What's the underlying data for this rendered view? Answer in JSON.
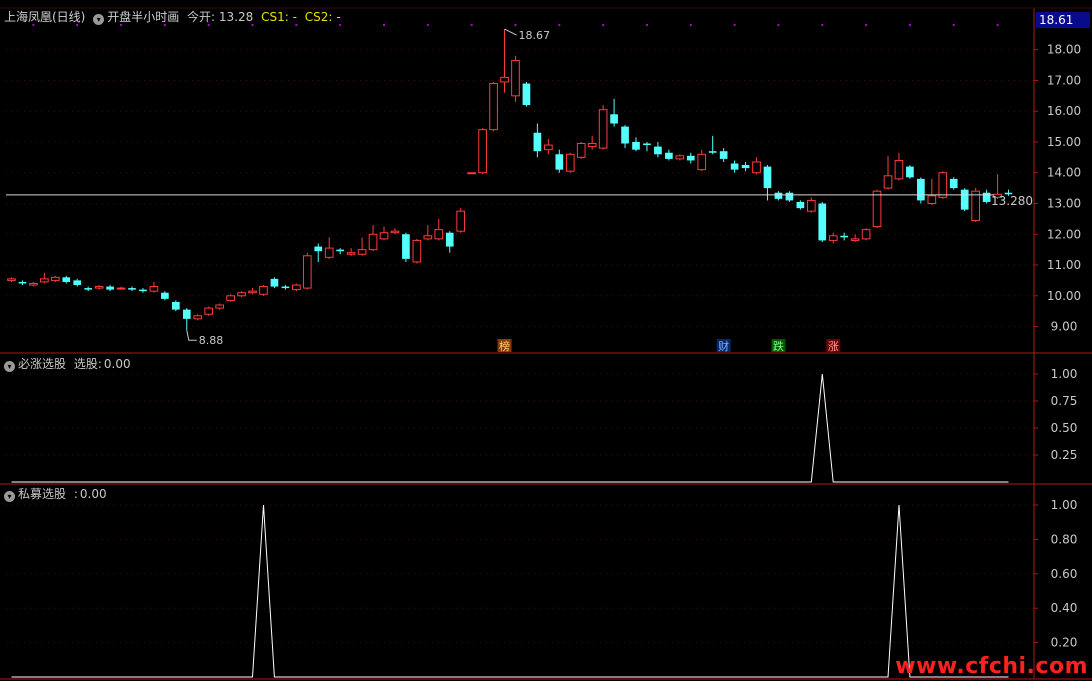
{
  "header": {
    "stock_name": "上海凤凰(日线)",
    "indicator_name": "开盘半小时画",
    "open_label": "今开:",
    "open_value": "13.28",
    "cs1_label": "CS1:",
    "cs1_value": "-",
    "cs2_label": "CS2:",
    "cs2_value": "-"
  },
  "current_price_box": "18.61",
  "panel2": {
    "title": "必涨选股",
    "label": "选股:",
    "value": "0.00"
  },
  "panel3": {
    "title": "私募选股",
    "label": ":",
    "value": "0.00"
  },
  "watermark": "www.cfchi.com",
  "colors": {
    "up": "#ff3b3b",
    "down": "#54ffff",
    "axis": "#b01818",
    "text": "#c8c8c8",
    "yellow": "#e8e000",
    "purple": "#b000d0"
  },
  "chart_data": [
    {
      "type": "candlestick",
      "ylim": [
        8.4,
        18.9
      ],
      "yticks": [
        "18.00",
        "17.00",
        "16.00",
        "15.00",
        "14.00",
        "13.00",
        "12.00",
        "11.00",
        "10.00",
        "9.00"
      ],
      "high_label": "18.67",
      "low_label": "8.88",
      "ref_line_label": "13.280",
      "ref_line_value": 13.28,
      "event_markers": [
        "榜",
        "财",
        "跌",
        "涨"
      ],
      "candles": [
        [
          10.5,
          10.55,
          10.6,
          10.45
        ],
        [
          10.45,
          10.4,
          10.5,
          10.35
        ],
        [
          10.35,
          10.4,
          10.45,
          10.3
        ],
        [
          10.45,
          10.55,
          10.75,
          10.4
        ],
        [
          10.5,
          10.6,
          10.65,
          10.45
        ],
        [
          10.6,
          10.45,
          10.65,
          10.4
        ],
        [
          10.5,
          10.35,
          10.55,
          10.3
        ],
        [
          10.25,
          10.2,
          10.3,
          10.15
        ],
        [
          10.25,
          10.3,
          10.35,
          10.2
        ],
        [
          10.3,
          10.2,
          10.35,
          10.15
        ],
        [
          10.25,
          10.25,
          10.3,
          10.2
        ],
        [
          10.25,
          10.2,
          10.3,
          10.15
        ],
        [
          10.2,
          10.15,
          10.25,
          10.1
        ],
        [
          10.15,
          10.3,
          10.45,
          10.1
        ],
        [
          10.1,
          9.9,
          10.15,
          9.85
        ],
        [
          9.8,
          9.55,
          9.85,
          9.5
        ],
        [
          9.55,
          9.25,
          9.6,
          8.88
        ],
        [
          9.25,
          9.35,
          9.4,
          9.2
        ],
        [
          9.4,
          9.6,
          9.65,
          9.35
        ],
        [
          9.6,
          9.7,
          9.75,
          9.55
        ],
        [
          9.85,
          10.0,
          10.05,
          9.8
        ],
        [
          10.0,
          10.1,
          10.15,
          9.95
        ],
        [
          10.1,
          10.15,
          10.25,
          10.05
        ],
        [
          10.05,
          10.3,
          10.35,
          10.0
        ],
        [
          10.55,
          10.3,
          10.6,
          10.25
        ],
        [
          10.3,
          10.25,
          10.35,
          10.2
        ],
        [
          10.2,
          10.35,
          10.4,
          10.15
        ],
        [
          10.25,
          11.3,
          11.4,
          10.2
        ],
        [
          11.6,
          11.45,
          11.7,
          11.1
        ],
        [
          11.25,
          11.55,
          11.9,
          11.2
        ],
        [
          11.5,
          11.45,
          11.55,
          11.35
        ],
        [
          11.35,
          11.4,
          11.55,
          11.3
        ],
        [
          11.35,
          11.5,
          11.9,
          11.3
        ],
        [
          11.5,
          12.0,
          12.3,
          11.45
        ],
        [
          11.85,
          12.05,
          12.25,
          11.8
        ],
        [
          12.05,
          12.1,
          12.2,
          12.0
        ],
        [
          12.0,
          11.2,
          12.05,
          11.1
        ],
        [
          11.1,
          11.8,
          11.85,
          11.05
        ],
        [
          11.85,
          11.95,
          12.3,
          11.8
        ],
        [
          11.85,
          12.15,
          12.5,
          11.8
        ],
        [
          12.05,
          11.6,
          12.1,
          11.4
        ],
        [
          12.1,
          12.75,
          12.85,
          12.05
        ],
        [
          14.0,
          14.0,
          14.0,
          14.0
        ],
        [
          14.0,
          15.4,
          15.45,
          13.95
        ],
        [
          15.4,
          16.9,
          16.95,
          15.35
        ],
        [
          16.95,
          17.1,
          18.67,
          16.6
        ],
        [
          16.5,
          17.65,
          17.8,
          16.3
        ],
        [
          16.9,
          16.2,
          16.95,
          16.15
        ],
        [
          15.3,
          14.7,
          15.6,
          14.5
        ],
        [
          14.75,
          14.9,
          15.1,
          14.6
        ],
        [
          14.6,
          14.1,
          14.75,
          14.0
        ],
        [
          14.05,
          14.6,
          14.65,
          14.0
        ],
        [
          14.5,
          14.95,
          15.0,
          14.45
        ],
        [
          14.85,
          14.95,
          15.2,
          14.75
        ],
        [
          14.8,
          16.05,
          16.2,
          14.75
        ],
        [
          15.9,
          15.6,
          16.4,
          15.5
        ],
        [
          15.5,
          14.95,
          15.55,
          14.8
        ],
        [
          15.0,
          14.75,
          15.15,
          14.7
        ],
        [
          14.95,
          14.9,
          15.0,
          14.7
        ],
        [
          14.85,
          14.6,
          15.0,
          14.5
        ],
        [
          14.65,
          14.45,
          14.75,
          14.4
        ],
        [
          14.45,
          14.55,
          14.6,
          14.4
        ],
        [
          14.55,
          14.4,
          14.65,
          14.3
        ],
        [
          14.1,
          14.6,
          14.75,
          14.05
        ],
        [
          14.7,
          14.65,
          15.2,
          14.6
        ],
        [
          14.7,
          14.45,
          14.8,
          14.35
        ],
        [
          14.3,
          14.1,
          14.4,
          14.0
        ],
        [
          14.25,
          14.15,
          14.35,
          14.05
        ],
        [
          14.0,
          14.35,
          14.5,
          13.95
        ],
        [
          14.2,
          13.5,
          14.25,
          13.1
        ],
        [
          13.35,
          13.15,
          13.4,
          13.1
        ],
        [
          13.35,
          13.1,
          13.4,
          13.05
        ],
        [
          13.05,
          12.85,
          13.1,
          12.8
        ],
        [
          12.75,
          13.1,
          13.2,
          12.7
        ],
        [
          13.0,
          11.8,
          13.05,
          11.75
        ],
        [
          11.8,
          11.95,
          12.05,
          11.7
        ],
        [
          11.95,
          11.9,
          12.05,
          11.8
        ],
        [
          11.8,
          11.85,
          12.0,
          11.75
        ],
        [
          11.85,
          12.15,
          12.2,
          11.8
        ],
        [
          12.25,
          13.4,
          13.45,
          12.2
        ],
        [
          13.5,
          13.9,
          14.55,
          13.45
        ],
        [
          13.8,
          14.4,
          14.65,
          13.75
        ],
        [
          14.2,
          13.85,
          14.25,
          13.8
        ],
        [
          13.8,
          13.1,
          13.85,
          13.0
        ],
        [
          13.0,
          13.25,
          13.8,
          12.95
        ],
        [
          13.2,
          14.0,
          14.05,
          13.15
        ],
        [
          13.8,
          13.5,
          13.85,
          13.45
        ],
        [
          13.45,
          12.8,
          13.5,
          12.75
        ],
        [
          12.45,
          13.4,
          13.5,
          12.4
        ],
        [
          13.35,
          13.05,
          13.45,
          13.0
        ],
        [
          13.2,
          13.3,
          13.95,
          13.15
        ],
        [
          13.35,
          13.3,
          13.45,
          13.25
        ]
      ]
    },
    {
      "type": "line",
      "series": [
        {
          "values": [
            0,
            0,
            0,
            0,
            0,
            0,
            0,
            0,
            0,
            0,
            0,
            0,
            0,
            0,
            0,
            0,
            0,
            0,
            0,
            0,
            0,
            0,
            0,
            0,
            0,
            0,
            0,
            0,
            0,
            0,
            0,
            0,
            0,
            0,
            0,
            0,
            0,
            0,
            0,
            0,
            0,
            0,
            0,
            0,
            0,
            0,
            0,
            0,
            0,
            0,
            0,
            0,
            0,
            0,
            0,
            0,
            0,
            0,
            0,
            0,
            0,
            0,
            0,
            0,
            0,
            0,
            0,
            0,
            0,
            0,
            0,
            0,
            0,
            0,
            1,
            0,
            0,
            0,
            0,
            0,
            0,
            0,
            0,
            0,
            0,
            0,
            0,
            0,
            0,
            0,
            0,
            0
          ]
        }
      ],
      "ylim": [
        0,
        1.0
      ],
      "yticks": [
        "1.00",
        "0.75",
        "0.50",
        "0.25"
      ]
    },
    {
      "type": "line",
      "series": [
        {
          "values": [
            0,
            0,
            0,
            0,
            0,
            0,
            0,
            0,
            0,
            0,
            0,
            0,
            0,
            0,
            0,
            0,
            0,
            0,
            0,
            0,
            0,
            0,
            0,
            1,
            0,
            0,
            0,
            0,
            0,
            0,
            0,
            0,
            0,
            0,
            0,
            0,
            0,
            0,
            0,
            0,
            0,
            0,
            0,
            0,
            0,
            0,
            0,
            0,
            0,
            0,
            0,
            0,
            0,
            0,
            0,
            0,
            0,
            0,
            0,
            0,
            0,
            0,
            0,
            0,
            0,
            0,
            0,
            0,
            0,
            0,
            0,
            0,
            0,
            0,
            0,
            0,
            0,
            0,
            0,
            0,
            0,
            1,
            0,
            0,
            0,
            0,
            0,
            0,
            0,
            0,
            0,
            0
          ]
        }
      ],
      "ylim": [
        0,
        1.0
      ],
      "yticks": [
        "1.00",
        "0.80",
        "0.60",
        "0.40",
        "0.20"
      ]
    }
  ]
}
